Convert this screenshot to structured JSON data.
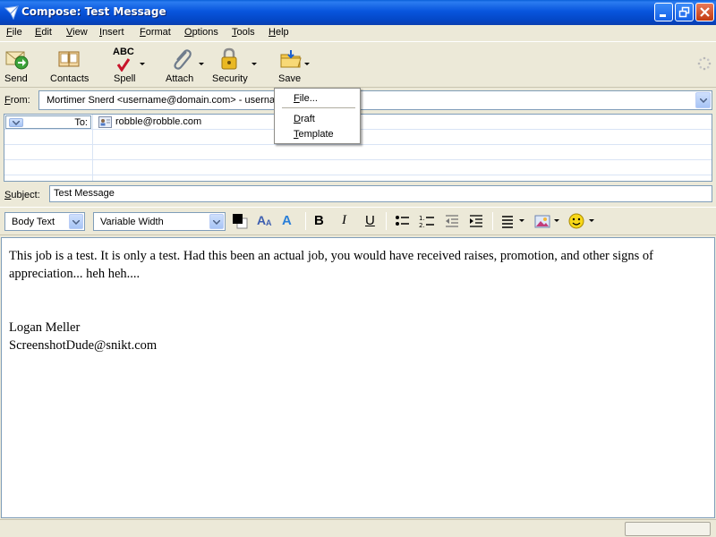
{
  "window": {
    "title": "Compose: Test Message",
    "buttons": [
      "minimize",
      "maximize",
      "close"
    ]
  },
  "menubar": {
    "items": [
      {
        "label": "File",
        "mnemonic": "F",
        "rest": "ile"
      },
      {
        "label": "Edit",
        "mnemonic": "E",
        "rest": "dit"
      },
      {
        "label": "View",
        "mnemonic": "V",
        "rest": "iew"
      },
      {
        "label": "Insert",
        "mnemonic": "I",
        "rest": "nsert"
      },
      {
        "label": "Format",
        "mnemonic": "F",
        "rest": "ormat"
      },
      {
        "label": "Options",
        "mnemonic": "O",
        "rest": "ptions"
      },
      {
        "label": "Tools",
        "mnemonic": "T",
        "rest": "ools"
      },
      {
        "label": "Help",
        "mnemonic": "H",
        "rest": "elp"
      }
    ]
  },
  "toolbar": {
    "send": "Send",
    "contacts": "Contacts",
    "spell": "Spell",
    "spell_icon_text": "ABC",
    "attach": "Attach",
    "security": "Security",
    "save": "Save"
  },
  "save_menu": {
    "file": {
      "mnemonic": "F",
      "rest": "ile..."
    },
    "draft": {
      "mnemonic": "D",
      "rest": "raft"
    },
    "template": {
      "mnemonic": "T",
      "rest": "emplate"
    }
  },
  "compose": {
    "from_label_mn": "F",
    "from_label_rest": "rom:",
    "from_value": "Mortimer Snerd <username@domain.com>     - username@domain.com",
    "to_label": "To:",
    "to_value": "robble@robble.com",
    "subject_label_mn": "S",
    "subject_label_rest": "ubject:",
    "subject_value": "Test Message"
  },
  "format_toolbar": {
    "paragraph_style": "Body Text",
    "font": "Variable Width",
    "bold": "B",
    "italic": "I",
    "underline": "U"
  },
  "body": {
    "paragraph1": "This job is a test.  It is only a test.  Had this been an actual job, you would have received raises, promotion, and other signs of appreciation... heh heh....",
    "signature_name": "Logan Meller",
    "signature_email": "ScreenshotDude@snikt.com"
  },
  "colors": {
    "titlebar": "#0855dd",
    "chrome": "#ece9d8",
    "close_button": "#c23a10",
    "field_border": "#7f9db9"
  }
}
